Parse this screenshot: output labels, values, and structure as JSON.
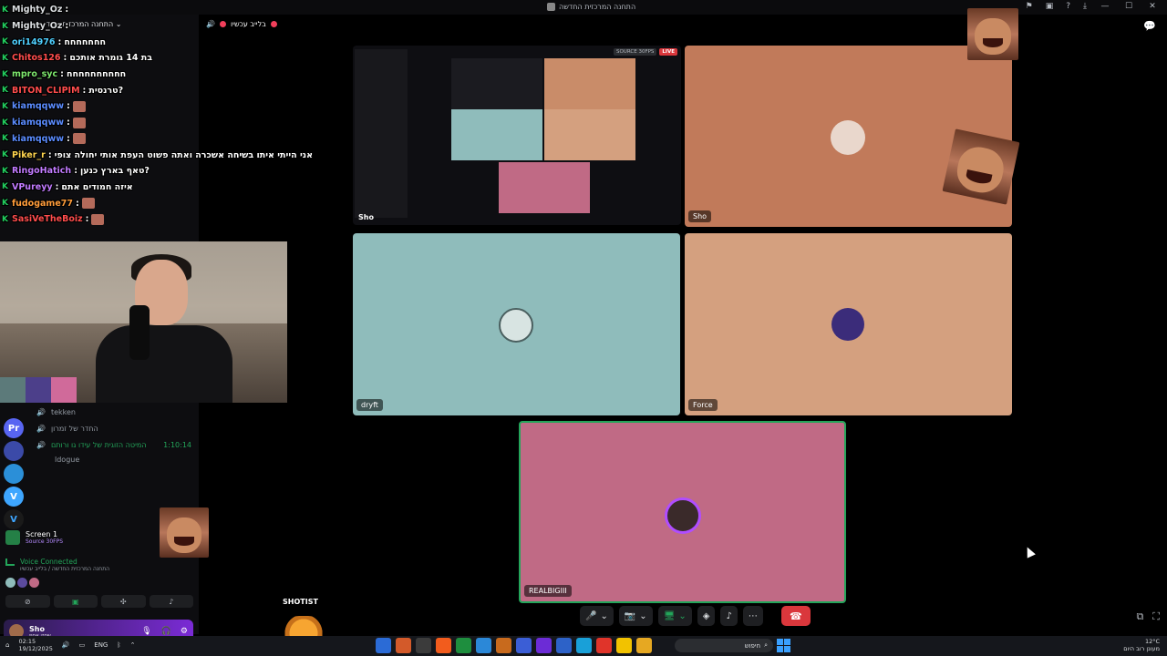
{
  "window": {
    "title": "התחנה המרכזית החדשה",
    "controls": [
      "—",
      "☐",
      "✕"
    ],
    "toolbar_icons": [
      "inbox-icon",
      "monitor-icon",
      "help-icon",
      "download-icon"
    ]
  },
  "voice_channel": {
    "title": "בלייב עכשיו",
    "header": "התחנה המרכזית החדשה ⌄",
    "channels": [
      {
        "name": "tekken"
      },
      {
        "name": "החדר של זמרון"
      },
      {
        "name": "המיטה הזוגית של עידו גו ורותם",
        "timer": "1:10:14"
      },
      {
        "name": "ldogue"
      }
    ]
  },
  "chat": {
    "lines": [
      {
        "user": "Mighty_Oz",
        "color": "#ffffff",
        "msg": ""
      },
      {
        "user": "Mighty_Oz",
        "color": "#ffffff",
        "msg": ""
      },
      {
        "user": "ori14976",
        "color": "#4fd0ff",
        "msg": "חחחחחחח"
      },
      {
        "user": "Chitos126",
        "color": "#ff4d4d",
        "msg": "בת 14 גומרת אותכם"
      },
      {
        "user": "mpro_syc",
        "color": "#7ee86e",
        "msg": "חחחחחחחחחח"
      },
      {
        "user": "BITON_CLIPIM",
        "color": "#ff4d4d",
        "msg": "טרנסית?"
      },
      {
        "user": "kiamqqww",
        "color": "#5b8cff",
        "msg": ""
      },
      {
        "user": "kiamqqww",
        "color": "#5b8cff",
        "msg": ""
      },
      {
        "user": "kiamqqww",
        "color": "#5b8cff",
        "msg": ""
      },
      {
        "user": "Piker_r",
        "color": "#ffd54f",
        "msg": "אני הייתי איתו בשיחה אשכרה ואתה פשוט העפת אותי יחולה צופי"
      },
      {
        "user": "RingoHatich",
        "color": "#c27bff",
        "msg": "טאף בארץ כנען?"
      },
      {
        "user": "VPureyy",
        "color": "#c27bff",
        "msg": "איזה חמודים אתם"
      },
      {
        "user": "fudogame77",
        "color": "#ff9c3a",
        "msg": ""
      },
      {
        "user": "SasiVeTheBoiz",
        "color": "#ff4d4d",
        "msg": ""
      }
    ]
  },
  "voice_panel": {
    "screen_label": "Screen 1",
    "screen_sub": "Source 30FPS",
    "connected": "Voice Connected",
    "path": "התחנה המרכזית החדשה / בלייב עכשיו",
    "buttons": [
      "camera-off-icon",
      "screen-share-icon",
      "activities-icon",
      "soundboard-icon"
    ]
  },
  "user": {
    "name": "Sho",
    "status": "שחק אספ"
  },
  "tiles": [
    {
      "name": "Sho",
      "kind": "share",
      "badge_src": "SOURCE 30FPS",
      "badge_live": "LIVE"
    },
    {
      "name": "Sho",
      "color": "#c17a5a"
    },
    {
      "name": "dryft",
      "color": "#8fbcbb"
    },
    {
      "name": "Force",
      "color": "#d4a07f"
    },
    {
      "name": "REALBIGIII",
      "color": "#c06a85"
    }
  ],
  "overlay": {
    "shotist": "SHOTIST"
  },
  "controls": {
    "mic": "🎤",
    "camera": "📷",
    "share": "🖥",
    "activity": "◈",
    "soundboard": "♪",
    "more": "⋯",
    "end_call": "☎"
  },
  "taskbar": {
    "time": "02:15",
    "date": "19/12/2025",
    "lang": "ENG",
    "search_placeholder": "חיפוש",
    "weather_temp": "12°C",
    "weather_desc": "מעונן רוב היום",
    "app_colors": [
      "#2b6bd6",
      "#d35a2a",
      "#3b3b3b",
      "#f25c1d",
      "#1e8e3e",
      "#2b88d8",
      "#c86a1d",
      "#3b5ed6",
      "#6c2cd6",
      "#2d62c8",
      "#19a0d8",
      "#e0342a",
      "#f2c200",
      "#e6a822"
    ]
  }
}
